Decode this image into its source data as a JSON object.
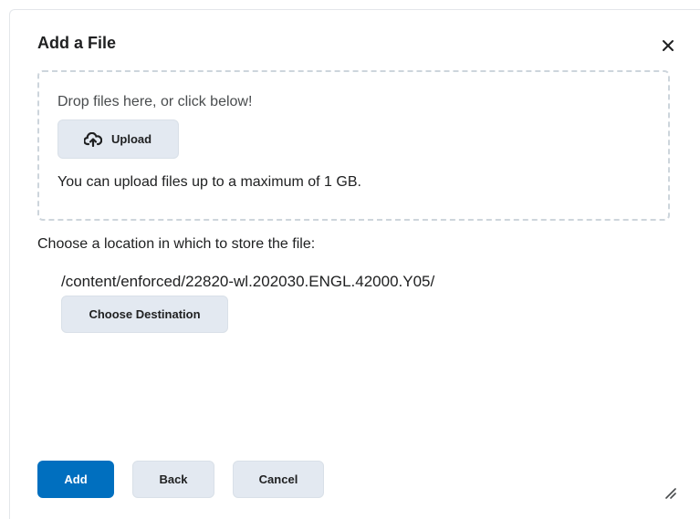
{
  "dialog": {
    "title": "Add a File",
    "close_icon": "close-icon"
  },
  "dropzone": {
    "instruction": "Drop files here, or click below!",
    "upload_label": "Upload",
    "upload_icon": "cloud-upload-icon",
    "limit_text": "You can upload files up to a maximum of 1 GB."
  },
  "location": {
    "label": "Choose a location in which to store the file:",
    "path": "/content/enforced/22820-wl.202030.ENGL.42000.Y05/",
    "choose_label": "Choose Destination"
  },
  "footer": {
    "add_label": "Add",
    "back_label": "Back",
    "cancel_label": "Cancel",
    "resize_icon": "resize-handle-icon"
  },
  "colors": {
    "primary": "#006fbf",
    "secondary_button": "#e3e9f1",
    "text": "#202122",
    "dropzone_border": "#cdd5dc"
  }
}
